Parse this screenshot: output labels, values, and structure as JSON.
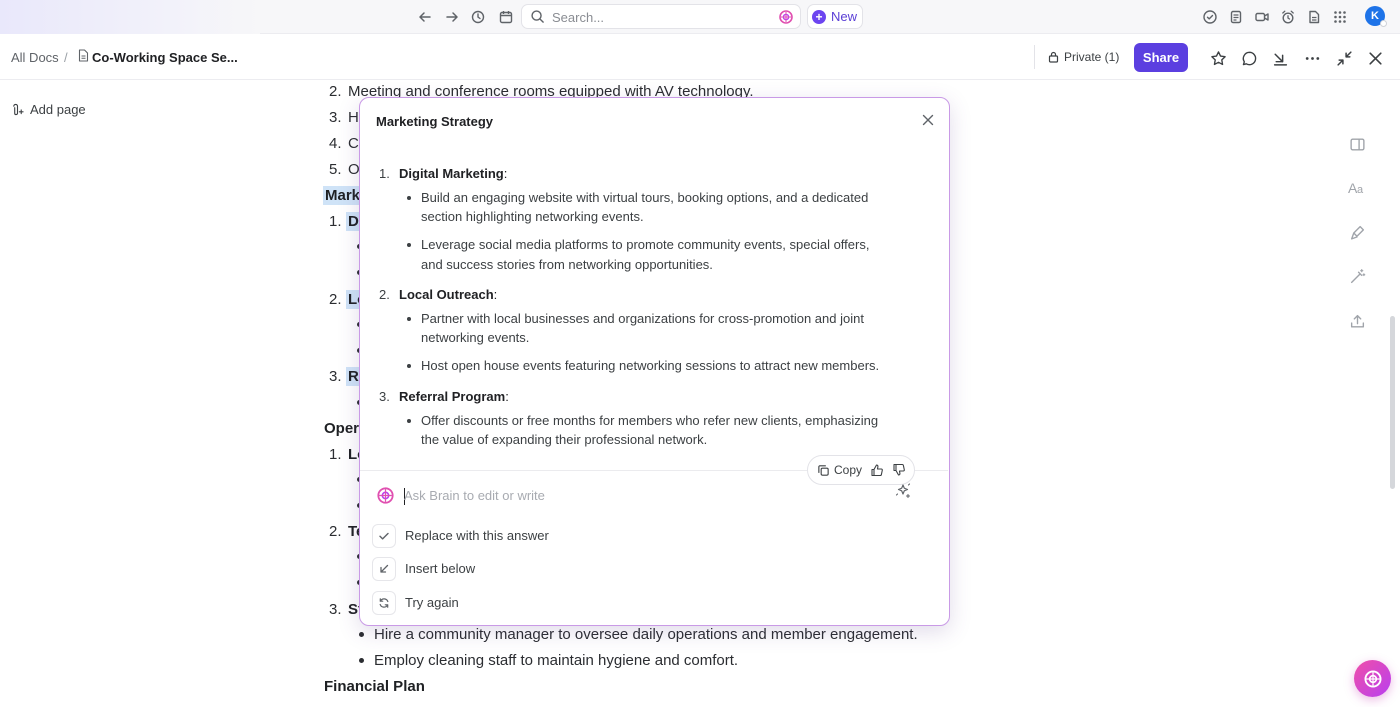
{
  "topbar": {
    "search_placeholder": "Search...",
    "new_label": "New",
    "avatar_initial": "K"
  },
  "header": {
    "breadcrumb_root": "All Docs",
    "breadcrumb_sep": "/",
    "doc_title": "Co-Working Space Se...",
    "privacy_label": "Private (1)",
    "share_label": "Share"
  },
  "sidebar": {
    "add_page_label": "Add page"
  },
  "document": {
    "lines": [
      {
        "num": "2.",
        "text": "Meeting and conference rooms equipped with AV technology."
      },
      {
        "num": "3.",
        "text": "H"
      },
      {
        "num": "4.",
        "text": "C"
      },
      {
        "num": "5.",
        "text": "O"
      }
    ],
    "heading_marketing_partial": "Mark",
    "item1_partial": "D",
    "item2_partial": "Lo",
    "item3_partial": "Re",
    "heading_operations_partial": "Oper",
    "op1_partial": "Lo",
    "op2_partial": "Te",
    "op3_partial": "St",
    "nums": {
      "n1": "1.",
      "n2": "2.",
      "n3": "3."
    },
    "staffing_bullets": [
      "Hire a community manager to oversee daily operations and member engagement.",
      "Employ cleaning staff to maintain hygiene and comfort."
    ],
    "heading_financial": "Financial Plan"
  },
  "ai_panel": {
    "title": "Marketing Strategy",
    "sections": [
      {
        "num": "1.",
        "heading": "Digital Marketing",
        "bullets": [
          [
            "Build an engaging website with virtual tours, booking options, and a dedicated",
            "section highlighting networking events."
          ],
          [
            "Leverage social media platforms to promote community events, special offers,",
            "and success stories from networking opportunities."
          ]
        ]
      },
      {
        "num": "2.",
        "heading": "Local Outreach",
        "bullets": [
          [
            "Partner with local businesses and organizations for cross-promotion and joint",
            "networking events."
          ],
          [
            "Host open house events featuring networking sessions to attract new members."
          ]
        ]
      },
      {
        "num": "3.",
        "heading": "Referral Program",
        "bullets": [
          [
            "Offer discounts or free months for members who refer new clients, emphasizing",
            "the value of expanding their professional network."
          ]
        ]
      }
    ],
    "copy_label": "Copy",
    "ask_placeholder": "Ask Brain to edit or write",
    "options": [
      "Replace with this answer",
      "Insert below",
      "Try again"
    ]
  },
  "colors": {
    "accent": "#5b3fe0",
    "highlight": "#cfe3f7",
    "panel_border": "#c99ae6",
    "brain_pink": "#f04fa8"
  }
}
